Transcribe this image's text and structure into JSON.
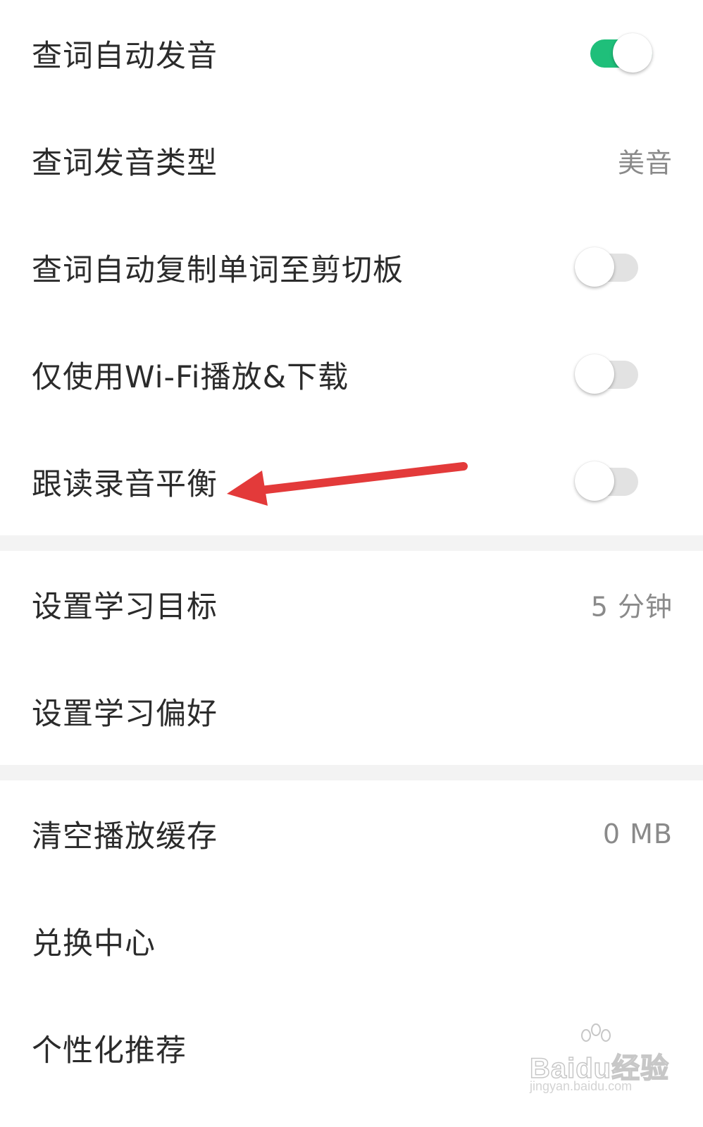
{
  "settings": {
    "auto_pronounce": {
      "label": "查词自动发音",
      "toggle_on": true
    },
    "pronounce_type": {
      "label": "查词发音类型",
      "value": "美音"
    },
    "auto_copy": {
      "label": "查词自动复制单词至剪切板",
      "toggle_on": false
    },
    "wifi_only": {
      "label": "仅使用Wi-Fi播放&下载",
      "toggle_on": false
    },
    "read_balance": {
      "label": "跟读录音平衡",
      "toggle_on": false
    },
    "study_goal": {
      "label": "设置学习目标",
      "value": "5 分钟"
    },
    "study_pref": {
      "label": "设置学习偏好"
    },
    "clear_cache": {
      "label": "清空播放缓存",
      "value": "0 MB"
    },
    "redeem_center": {
      "label": "兑换中心"
    },
    "personalized": {
      "label": "个性化推荐"
    }
  },
  "colors": {
    "toggle_on": "#1fbf7a",
    "toggle_off": "#e2e2e2",
    "annotation_arrow": "#e33a3a",
    "section_gap": "#f3f3f3"
  },
  "watermark": {
    "brand": "Baidu经验",
    "url": "jingyan.baidu.com"
  }
}
